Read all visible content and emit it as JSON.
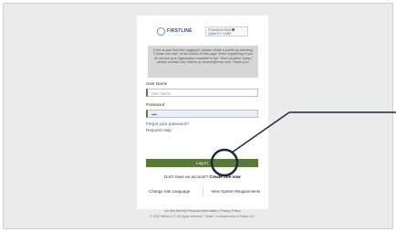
{
  "logos": {
    "primary": "FIRSTLINE",
    "secondary_line1": "FOUNDATIONS",
    "secondary_line2": "QUALITY CARE"
  },
  "info_text": "If this is your first time logging in, please create a profile by selecting \"Create one now\" at the bottom of this page. When registering, if you do not see your organization available in the \"User Location\" menu, please contact Cory Marvin at cmarvin@rmsu.com. Thank you!",
  "username": {
    "label": "User Name",
    "placeholder": "User Name"
  },
  "password": {
    "label": "Password",
    "value": "••••"
  },
  "links": {
    "forgot": "Forgot your password?",
    "help": "Request Help"
  },
  "login_label": "Log In",
  "signup": {
    "prompt": "Don't have an account?",
    "link": "Create one now"
  },
  "bottom": {
    "language": "Change Site Language",
    "requirements": "View System Requirements"
  },
  "footer": {
    "line1": "Do Not Sell My Personal Information  |  Privacy Policy",
    "line2": "© 2022 Relias LLC. All rights reserved. \"Relias\" is a trademark of Relias LLC."
  },
  "colors": {
    "accent": "#587a35",
    "annotation": "#1a2a44"
  }
}
